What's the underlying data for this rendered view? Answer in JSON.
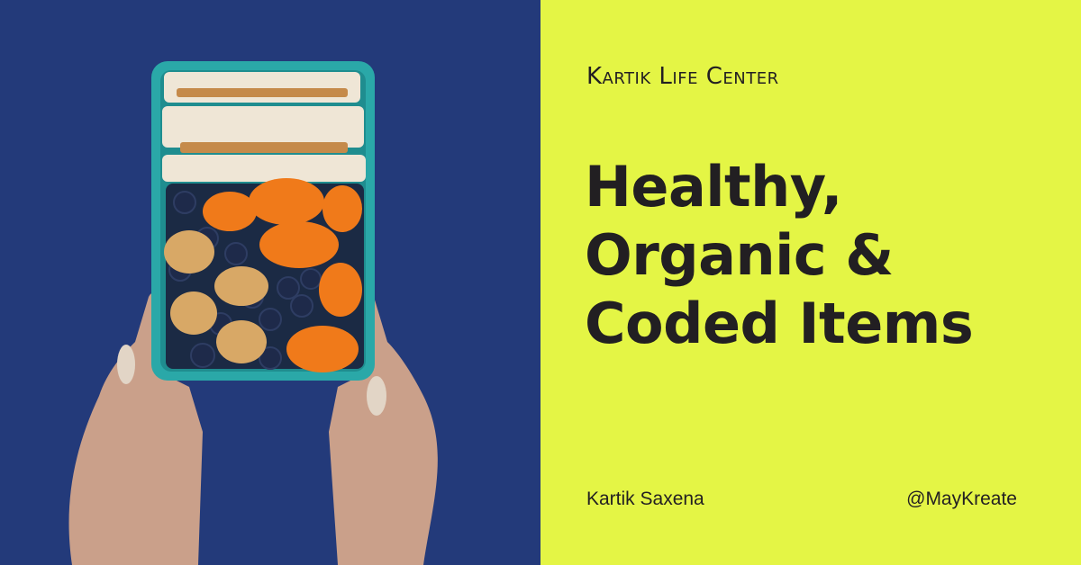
{
  "brand": {
    "name": "Kartik Life Center"
  },
  "headline": {
    "lines": [
      "Healthy,",
      "Organic &",
      "Coded Items"
    ]
  },
  "footer": {
    "author": "Kartik Saxena",
    "handle": "@MayKreate"
  },
  "colors": {
    "photo_background": "#233a7a",
    "panel_background": "#e4f545",
    "text": "#221f22",
    "lunchbox": "#2aa8a8"
  },
  "image": {
    "subject": "hands-holding-lunchbox-icon"
  }
}
